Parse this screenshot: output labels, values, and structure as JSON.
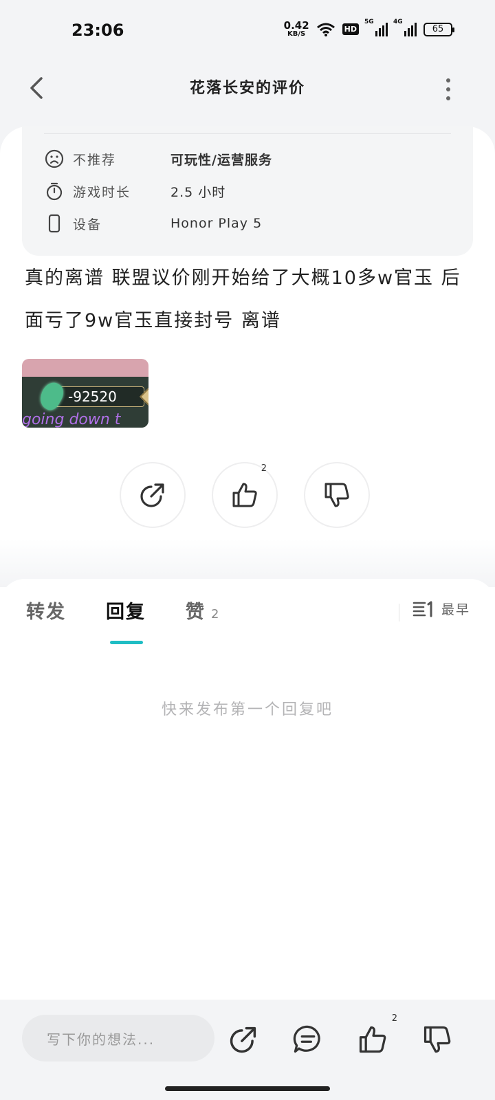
{
  "status_bar": {
    "time": "23:06",
    "net_speed_value": "0.42",
    "net_speed_unit": "KB/S",
    "hd_badge": "HD",
    "signal_1_label": "5G",
    "signal_2_label": "4G",
    "battery": "65"
  },
  "header": {
    "title": "花落长安的评价"
  },
  "review_info": {
    "rows": [
      {
        "icon": "sad-face-icon",
        "label": "不推荐",
        "value": "可玩性/运营服务"
      },
      {
        "icon": "timer-icon",
        "label": "游戏时长",
        "value": "2.5 小时"
      },
      {
        "icon": "phone-icon",
        "label": "设备",
        "value": "Honor Play 5"
      }
    ]
  },
  "review": {
    "text": "真的离谱 联盟议价刚开始给了大概10多w官玉 后面亏了9w官玉直接封号 离谱",
    "image": {
      "amount": "-92520",
      "caption": "going down t",
      "plus": "+"
    }
  },
  "actions": {
    "share_icon": "share-icon",
    "like_icon": "thumbs-up-icon",
    "like_count": "2",
    "dislike_icon": "thumbs-down-icon"
  },
  "tabs": {
    "items": [
      {
        "label": "转发",
        "count": ""
      },
      {
        "label": "回复",
        "count": ""
      },
      {
        "label": "赞",
        "count": "2"
      }
    ],
    "active_index": 1,
    "sort_label": "最早",
    "empty_text": "快来发布第一个回复吧"
  },
  "bottom_bar": {
    "input_placeholder": "写下你的想法...",
    "like_count": "2"
  },
  "colors": {
    "accent": "#1fbdc4",
    "background": "#f3f4f6",
    "card": "#ffffff",
    "info_box": "#f4f5f6"
  }
}
